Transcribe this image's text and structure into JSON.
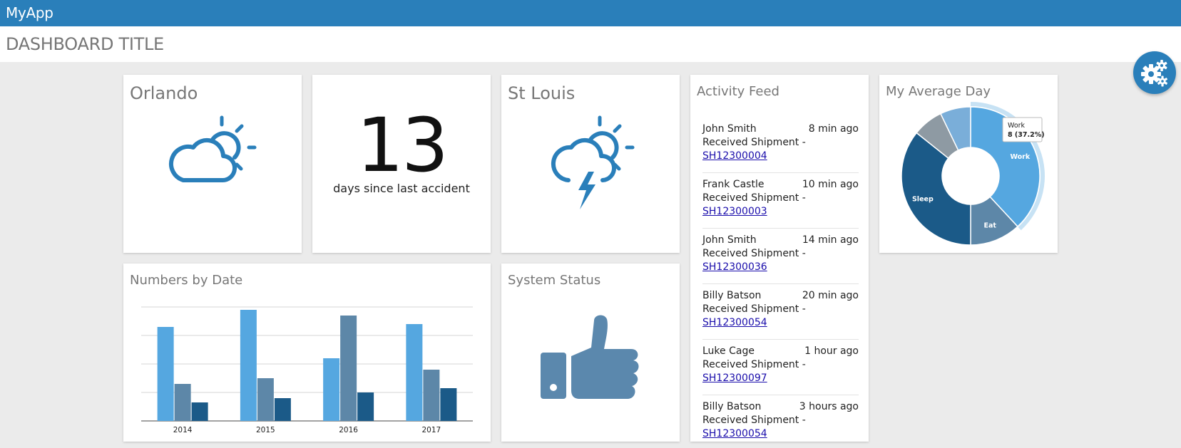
{
  "app": {
    "name": "MyApp"
  },
  "page": {
    "title": "DASHBOARD TITLE"
  },
  "colors": {
    "header": "#2a7fba",
    "icon_blue": "#2a7fba",
    "thumb": "#5b88ad",
    "bar_light": "#55a7e0",
    "bar_mid": "#5d87a8",
    "bar_dark": "#1b5a88",
    "link": "#1a0dab"
  },
  "settings_button": {
    "icon": "gears-icon"
  },
  "weather_orlando": {
    "title": "Orlando",
    "icon": "partly-cloudy-icon"
  },
  "accident": {
    "value": "13",
    "caption": "days since last accident"
  },
  "weather_stlouis": {
    "title": "St Louis",
    "icon": "thunderstorm-icon"
  },
  "activity_feed": {
    "title": "Activity Feed",
    "items": [
      {
        "name": "John Smith",
        "time": "8 min ago",
        "action": "Received Shipment -",
        "link": "SH12300004"
      },
      {
        "name": "Frank Castle",
        "time": "10 min ago",
        "action": "Received Shipment -",
        "link": "SH12300003"
      },
      {
        "name": "John Smith",
        "time": "14 min ago",
        "action": "Received Shipment -",
        "link": "SH12300036"
      },
      {
        "name": "Billy Batson",
        "time": "20 min ago",
        "action": "Received Shipment -",
        "link": "SH12300054"
      },
      {
        "name": "Luke Cage",
        "time": "1 hour ago",
        "action": "Received Shipment -",
        "link": "SH12300097"
      },
      {
        "name": "Billy Batson",
        "time": "3 hours ago",
        "action": "Received Shipment -",
        "link": "SH12300054"
      }
    ]
  },
  "average_day": {
    "title": "My Average Day",
    "tooltip": {
      "label": "Work",
      "value": "8 (37.2%)"
    }
  },
  "numbers_by_date": {
    "title": "Numbers by Date"
  },
  "system_status": {
    "title": "System Status",
    "icon": "thumbs-up-icon"
  },
  "chart_data": [
    {
      "type": "pie",
      "title": "My Average Day",
      "labels": [
        "Work",
        "Eat",
        "Sleep",
        "",
        ""
      ],
      "values": [
        8,
        2.5,
        7.5,
        1.5,
        1.5
      ],
      "colors": [
        "#55a7e0",
        "#5d87a8",
        "#1b5a88",
        "#8e9aa3",
        "#7aaed9"
      ],
      "highlighted": "Work",
      "donut": true
    },
    {
      "type": "bar",
      "title": "Numbers by Date",
      "categories": [
        "2014",
        "2015",
        "2016",
        "2017"
      ],
      "series": [
        {
          "values": [
            330,
            390,
            220,
            340
          ],
          "color": "#55a7e0"
        },
        {
          "values": [
            130,
            150,
            370,
            180
          ],
          "color": "#5d87a8"
        },
        {
          "values": [
            65,
            80,
            100,
            115
          ],
          "color": "#1b5a88"
        }
      ],
      "ylim": [
        0,
        400
      ],
      "grid": true
    }
  ]
}
